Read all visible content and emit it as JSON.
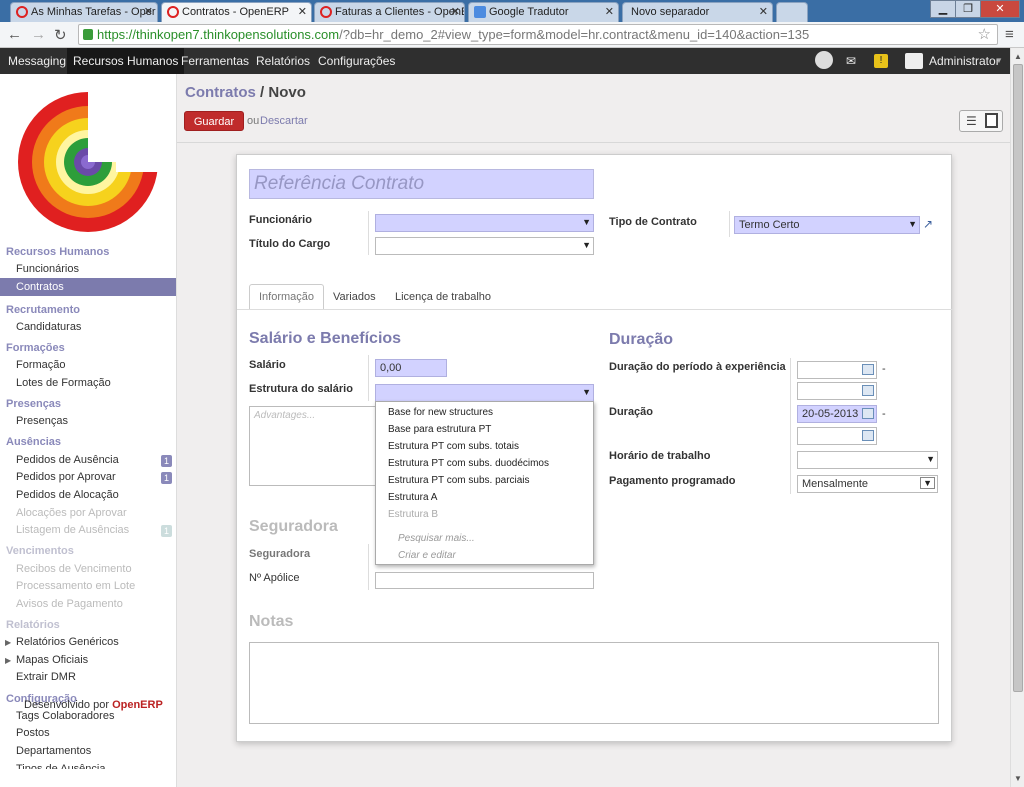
{
  "browser": {
    "tabs": [
      {
        "label": "As Minhas Tarefas - Oper"
      },
      {
        "label": "Contratos - OpenERP"
      },
      {
        "label": "Faturas a Clientes - OpenE"
      },
      {
        "label": "Google Tradutor"
      },
      {
        "label": "Novo separador"
      }
    ],
    "url_host": "https://thinkopen7.thinkopensolutions.com",
    "url_path": "/?db=hr_demo_2#view_type=form&model=hr.contract&menu_id=140&action=135"
  },
  "topmenu": {
    "items": [
      "Messaging",
      "Recursos Humanos",
      "Ferramentas",
      "Relatórios",
      "Configurações"
    ],
    "user": "Administrator"
  },
  "sidebar": {
    "sections": [
      {
        "title": "Recursos Humanos",
        "items": [
          "Funcionários",
          "Contratos"
        ]
      },
      {
        "title": "Recrutamento",
        "items": [
          "Candidaturas"
        ]
      },
      {
        "title": "Formações",
        "items": [
          "Formação",
          "Lotes de Formação"
        ]
      },
      {
        "title": "Presenças",
        "items": [
          "Presenças"
        ]
      },
      {
        "title": "Ausências",
        "items": [
          "Pedidos de Ausência",
          "Pedidos por Aprovar",
          "Pedidos de Alocação",
          "Alocações por Aprovar",
          "Listagem de Ausências"
        ]
      },
      {
        "title": "Vencimentos",
        "items": [
          "Recibos de Vencimento",
          "Processamento em Lote",
          "Avisos de Pagamento"
        ]
      },
      {
        "title": "Relatórios",
        "items": [
          "Relatórios Genéricos",
          "Mapas Oficiais",
          "Extrair DMR"
        ]
      },
      {
        "title": "Configuração",
        "items": [
          "Tags Colaboradores",
          "Postos",
          "Departamentos",
          "Tipos de Ausência"
        ]
      }
    ],
    "badges": [
      "1",
      "1",
      "1"
    ],
    "footer_prefix": "Desenvolvido por",
    "footer_brand": "OpenERP"
  },
  "main": {
    "breadcrumb_parent": "Contratos",
    "breadcrumb_sep": "/",
    "breadcrumb_current": "Novo",
    "save_label": "Guardar",
    "or_label": "ou",
    "discard_label": "Descartar"
  },
  "form": {
    "reference_placeholder": "Referência Contrato",
    "employee_label": "Funcionário",
    "job_title_label": "Título do Cargo",
    "contract_type_label": "Tipo de Contrato",
    "contract_type_value": "Termo Certo",
    "tabs": [
      "Informação",
      "Variados",
      "Licença de trabalho"
    ],
    "salary_section": "Salário e Benefícios",
    "salary_label": "Salário",
    "salary_value": "0,00",
    "structure_label": "Estrutura do salário",
    "advantages_placeholder": "Advantages...",
    "duration_section": "Duração",
    "trial_label": "Duração do período à experiência",
    "duration_label": "Duração",
    "duration_start": "20-05-2013",
    "dash": "-",
    "schedule_label": "Horário de trabalho",
    "scheduled_pay_label": "Pagamento programado",
    "scheduled_pay_value": "Mensalmente",
    "insurer_section": "Seguradora",
    "insurer_label": "Seguradora",
    "policy_label": "Nº Apólice",
    "notes_section": "Notas"
  },
  "dropdown": {
    "options": [
      "Base for new structures",
      "Base para estrutura PT",
      "Estrutura PT com subs. totais",
      "Estrutura PT com subs. duodécimos",
      "Estrutura PT com subs. parciais",
      "Estrutura A",
      "Estrutura B"
    ],
    "search_more": "Pesquisar mais...",
    "create_edit": "Criar e editar"
  }
}
